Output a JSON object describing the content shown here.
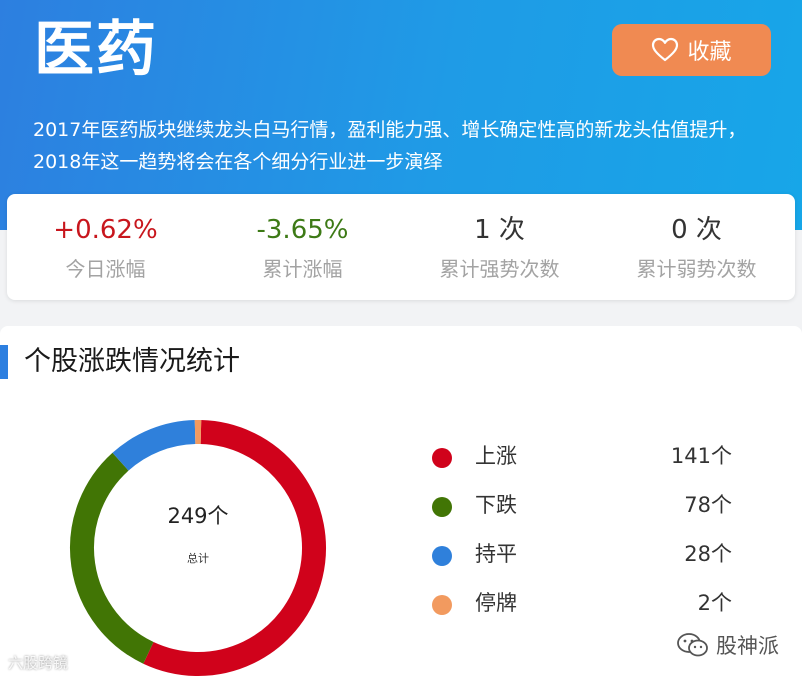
{
  "header": {
    "title": "医药",
    "favorite_label": "收藏",
    "description": "2017年医药版块继续龙头白马行情，盈利能力强、增长确定性高的新龙头估值提升，2018年这一趋势将会在各个细分行业进一步演绎"
  },
  "stats": [
    {
      "value": "+0.62%",
      "label": "今日涨幅",
      "color": "#c8161d"
    },
    {
      "value": "-3.65%",
      "label": "累计涨幅",
      "color": "#3d7a16"
    },
    {
      "value": "1 次",
      "label": "累计强势次数",
      "color": "#333333"
    },
    {
      "value": "0 次",
      "label": "累计弱势次数",
      "color": "#333333"
    }
  ],
  "distribution": {
    "section_title": "个股涨跌情况统计",
    "total_text": "249个",
    "total_label": "总计",
    "legend": [
      {
        "label": "上涨",
        "count_text": "141个",
        "value": 141,
        "color": "#d0021b"
      },
      {
        "label": "下跌",
        "count_text": "78个",
        "value": 78,
        "color": "#417505"
      },
      {
        "label": "持平",
        "count_text": "28个",
        "value": 28,
        "color": "#2f80db"
      },
      {
        "label": "停牌",
        "count_text": "2个",
        "value": 2,
        "color": "#f29a5f"
      }
    ]
  },
  "watermarks": {
    "left": "六股跨镜",
    "right": "股神派"
  },
  "icons": {
    "favorite": "heart-outline-icon",
    "right_watermark": "wechat-icon"
  }
}
